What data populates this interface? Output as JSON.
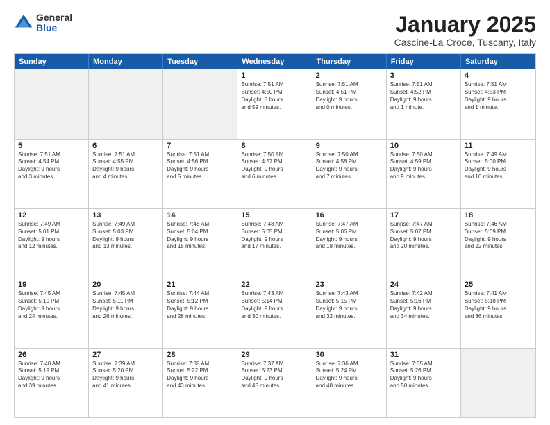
{
  "logo": {
    "general": "General",
    "blue": "Blue"
  },
  "title": "January 2025",
  "location": "Cascine-La Croce, Tuscany, Italy",
  "days_header": [
    "Sunday",
    "Monday",
    "Tuesday",
    "Wednesday",
    "Thursday",
    "Friday",
    "Saturday"
  ],
  "weeks": [
    [
      {
        "day": "",
        "shaded": true,
        "lines": []
      },
      {
        "day": "",
        "shaded": true,
        "lines": []
      },
      {
        "day": "",
        "shaded": true,
        "lines": []
      },
      {
        "day": "1",
        "shaded": false,
        "lines": [
          "Sunrise: 7:51 AM",
          "Sunset: 4:50 PM",
          "Daylight: 8 hours",
          "and 59 minutes."
        ]
      },
      {
        "day": "2",
        "shaded": false,
        "lines": [
          "Sunrise: 7:51 AM",
          "Sunset: 4:51 PM",
          "Daylight: 9 hours",
          "and 0 minutes."
        ]
      },
      {
        "day": "3",
        "shaded": false,
        "lines": [
          "Sunrise: 7:51 AM",
          "Sunset: 4:52 PM",
          "Daylight: 9 hours",
          "and 1 minute."
        ]
      },
      {
        "day": "4",
        "shaded": false,
        "lines": [
          "Sunrise: 7:51 AM",
          "Sunset: 4:53 PM",
          "Daylight: 9 hours",
          "and 1 minute."
        ]
      }
    ],
    [
      {
        "day": "5",
        "shaded": false,
        "lines": [
          "Sunrise: 7:51 AM",
          "Sunset: 4:54 PM",
          "Daylight: 9 hours",
          "and 3 minutes."
        ]
      },
      {
        "day": "6",
        "shaded": false,
        "lines": [
          "Sunrise: 7:51 AM",
          "Sunset: 4:55 PM",
          "Daylight: 9 hours",
          "and 4 minutes."
        ]
      },
      {
        "day": "7",
        "shaded": false,
        "lines": [
          "Sunrise: 7:51 AM",
          "Sunset: 4:56 PM",
          "Daylight: 9 hours",
          "and 5 minutes."
        ]
      },
      {
        "day": "8",
        "shaded": false,
        "lines": [
          "Sunrise: 7:50 AM",
          "Sunset: 4:57 PM",
          "Daylight: 9 hours",
          "and 6 minutes."
        ]
      },
      {
        "day": "9",
        "shaded": false,
        "lines": [
          "Sunrise: 7:50 AM",
          "Sunset: 4:58 PM",
          "Daylight: 9 hours",
          "and 7 minutes."
        ]
      },
      {
        "day": "10",
        "shaded": false,
        "lines": [
          "Sunrise: 7:50 AM",
          "Sunset: 4:59 PM",
          "Daylight: 9 hours",
          "and 9 minutes."
        ]
      },
      {
        "day": "11",
        "shaded": false,
        "lines": [
          "Sunrise: 7:49 AM",
          "Sunset: 5:00 PM",
          "Daylight: 9 hours",
          "and 10 minutes."
        ]
      }
    ],
    [
      {
        "day": "12",
        "shaded": false,
        "lines": [
          "Sunrise: 7:49 AM",
          "Sunset: 5:01 PM",
          "Daylight: 9 hours",
          "and 12 minutes."
        ]
      },
      {
        "day": "13",
        "shaded": false,
        "lines": [
          "Sunrise: 7:49 AM",
          "Sunset: 5:03 PM",
          "Daylight: 9 hours",
          "and 13 minutes."
        ]
      },
      {
        "day": "14",
        "shaded": false,
        "lines": [
          "Sunrise: 7:48 AM",
          "Sunset: 5:04 PM",
          "Daylight: 9 hours",
          "and 15 minutes."
        ]
      },
      {
        "day": "15",
        "shaded": false,
        "lines": [
          "Sunrise: 7:48 AM",
          "Sunset: 5:05 PM",
          "Daylight: 9 hours",
          "and 17 minutes."
        ]
      },
      {
        "day": "16",
        "shaded": false,
        "lines": [
          "Sunrise: 7:47 AM",
          "Sunset: 5:06 PM",
          "Daylight: 9 hours",
          "and 18 minutes."
        ]
      },
      {
        "day": "17",
        "shaded": false,
        "lines": [
          "Sunrise: 7:47 AM",
          "Sunset: 5:07 PM",
          "Daylight: 9 hours",
          "and 20 minutes."
        ]
      },
      {
        "day": "18",
        "shaded": false,
        "lines": [
          "Sunrise: 7:46 AM",
          "Sunset: 5:09 PM",
          "Daylight: 9 hours",
          "and 22 minutes."
        ]
      }
    ],
    [
      {
        "day": "19",
        "shaded": false,
        "lines": [
          "Sunrise: 7:45 AM",
          "Sunset: 5:10 PM",
          "Daylight: 9 hours",
          "and 24 minutes."
        ]
      },
      {
        "day": "20",
        "shaded": false,
        "lines": [
          "Sunrise: 7:45 AM",
          "Sunset: 5:11 PM",
          "Daylight: 9 hours",
          "and 26 minutes."
        ]
      },
      {
        "day": "21",
        "shaded": false,
        "lines": [
          "Sunrise: 7:44 AM",
          "Sunset: 5:12 PM",
          "Daylight: 9 hours",
          "and 28 minutes."
        ]
      },
      {
        "day": "22",
        "shaded": false,
        "lines": [
          "Sunrise: 7:43 AM",
          "Sunset: 5:14 PM",
          "Daylight: 9 hours",
          "and 30 minutes."
        ]
      },
      {
        "day": "23",
        "shaded": false,
        "lines": [
          "Sunrise: 7:43 AM",
          "Sunset: 5:15 PM",
          "Daylight: 9 hours",
          "and 32 minutes."
        ]
      },
      {
        "day": "24",
        "shaded": false,
        "lines": [
          "Sunrise: 7:42 AM",
          "Sunset: 5:16 PM",
          "Daylight: 9 hours",
          "and 34 minutes."
        ]
      },
      {
        "day": "25",
        "shaded": false,
        "lines": [
          "Sunrise: 7:41 AM",
          "Sunset: 5:18 PM",
          "Daylight: 9 hours",
          "and 36 minutes."
        ]
      }
    ],
    [
      {
        "day": "26",
        "shaded": false,
        "lines": [
          "Sunrise: 7:40 AM",
          "Sunset: 5:19 PM",
          "Daylight: 9 hours",
          "and 39 minutes."
        ]
      },
      {
        "day": "27",
        "shaded": false,
        "lines": [
          "Sunrise: 7:39 AM",
          "Sunset: 5:20 PM",
          "Daylight: 9 hours",
          "and 41 minutes."
        ]
      },
      {
        "day": "28",
        "shaded": false,
        "lines": [
          "Sunrise: 7:38 AM",
          "Sunset: 5:22 PM",
          "Daylight: 9 hours",
          "and 43 minutes."
        ]
      },
      {
        "day": "29",
        "shaded": false,
        "lines": [
          "Sunrise: 7:37 AM",
          "Sunset: 5:23 PM",
          "Daylight: 9 hours",
          "and 45 minutes."
        ]
      },
      {
        "day": "30",
        "shaded": false,
        "lines": [
          "Sunrise: 7:36 AM",
          "Sunset: 5:24 PM",
          "Daylight: 9 hours",
          "and 48 minutes."
        ]
      },
      {
        "day": "31",
        "shaded": false,
        "lines": [
          "Sunrise: 7:35 AM",
          "Sunset: 5:26 PM",
          "Daylight: 9 hours",
          "and 50 minutes."
        ]
      },
      {
        "day": "",
        "shaded": true,
        "lines": []
      }
    ]
  ]
}
